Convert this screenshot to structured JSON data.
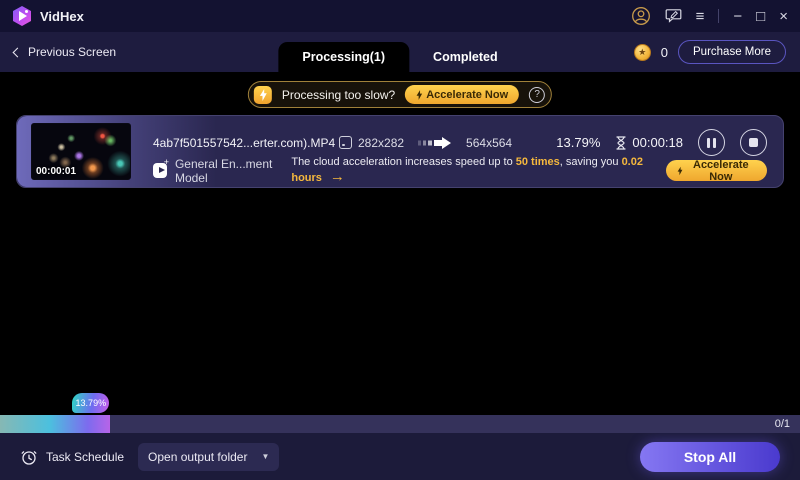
{
  "titlebar": {
    "app_name": "VidHex",
    "menu_glyph": "≡",
    "minimize_glyph": "−",
    "maximize_glyph": "□",
    "close_glyph": "×"
  },
  "nav": {
    "back_label": "Previous Screen",
    "tabs": [
      {
        "label": "Processing(1)",
        "active": true
      },
      {
        "label": "Completed",
        "active": false
      }
    ],
    "coin_glyph": "★",
    "coin_count": "0",
    "purchase_label": "Purchase More"
  },
  "banner": {
    "message": "Processing too slow?",
    "accelerate_label": "Accelerate Now",
    "help_glyph": "?"
  },
  "task": {
    "thumb_timestamp": "00:00:01",
    "filename": "4ab7f501557542...erter.com).MP4",
    "source_resolution": "282x282",
    "target_resolution": "564x564",
    "progress_percent": "13.79%",
    "elapsed_time": "00:00:18",
    "model_name": "General En...ment Model",
    "promo": {
      "text_start": "The cloud acceleration increases speed up to ",
      "highlight_speed": "50 times",
      "text_mid": ", saving you ",
      "highlight_saving": "0.02 hours",
      "arrow_glyph": "→",
      "accelerate_label": "Accelerate Now"
    }
  },
  "progress": {
    "percent": 13.79,
    "tooltip": "13.79%",
    "counter": "0/1"
  },
  "footer": {
    "task_schedule_label": "Task Schedule",
    "output_folder_label": "Open output folder",
    "caret_glyph": "▼",
    "stop_all_label": "Stop All"
  },
  "colors": {
    "accent_gold": "#f5b83d",
    "accent_purple": "#6c5ce7",
    "card_bg": "#2a2750",
    "progress_start": "#86b8b4",
    "progress_end": "#b764e8"
  }
}
